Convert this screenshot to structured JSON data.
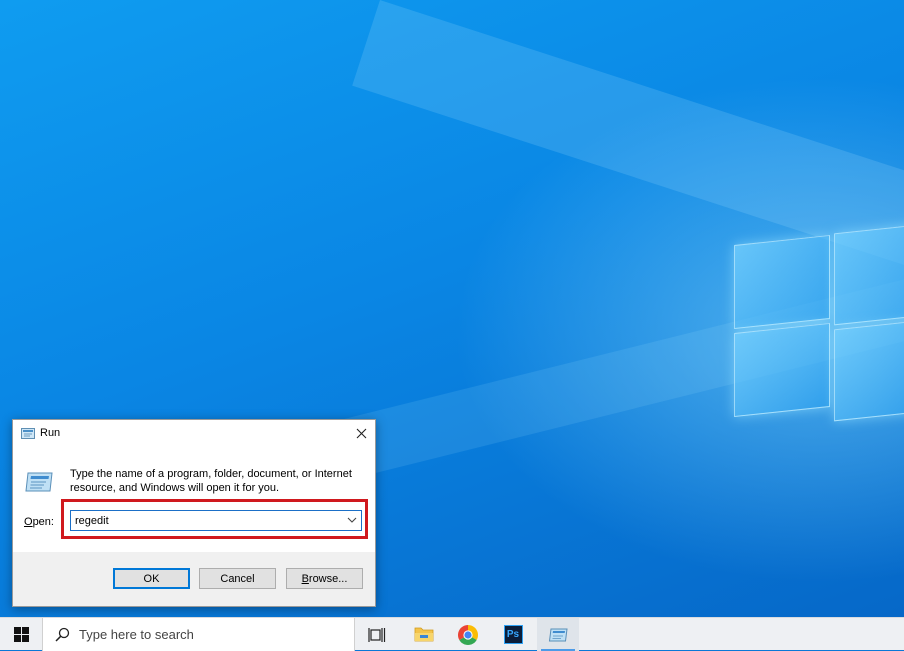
{
  "run_dialog": {
    "title": "Run",
    "description": "Type the name of a program, folder, document, or Internet resource, and Windows will open it for you.",
    "open_label_accesskey": "O",
    "open_label_rest": "pen:",
    "open_value": "regedit",
    "ok_label": "OK",
    "cancel_label": "Cancel",
    "browse_label_accesskey": "B",
    "browse_label_rest": "rowse..."
  },
  "taskbar": {
    "search_placeholder": "Type here to search",
    "pinned_icons": [
      "task-view-icon",
      "file-explorer-icon",
      "chrome-icon",
      "photoshop-icon",
      "run-icon"
    ],
    "photoshop_label": "Ps"
  },
  "colors": {
    "highlight_border": "#d0191e",
    "accent": "#0078d7",
    "desktop_blue": "#0a86e4"
  }
}
